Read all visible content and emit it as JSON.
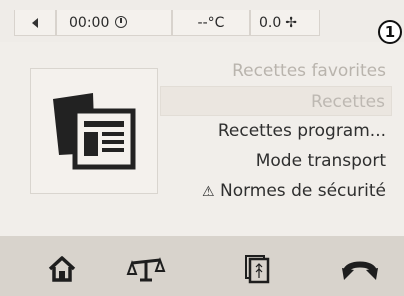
{
  "status": {
    "time": "00:00",
    "temperature": "--°C",
    "speed": "0.0"
  },
  "step_badge": "1",
  "menu": {
    "items": [
      {
        "label": "Recettes favorites",
        "state": "faded"
      },
      {
        "label": "Recettes",
        "state": "selected"
      },
      {
        "label": "Recettes program...",
        "state": "normal"
      },
      {
        "label": "Mode transport",
        "state": "normal"
      },
      {
        "label": "Normes de sécurité",
        "state": "normal",
        "icon": "warning-icon"
      }
    ]
  },
  "nav": {
    "icons": [
      "home-icon",
      "scale-icon",
      "recipe-book-icon",
      "undo-icon"
    ]
  }
}
